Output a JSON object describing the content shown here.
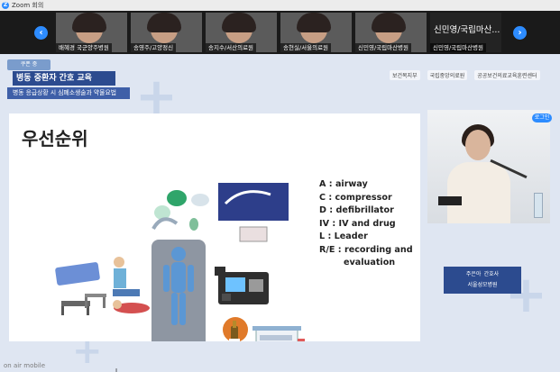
{
  "window": {
    "title": "Zoom 회의"
  },
  "gallery": {
    "tiles": [
      {
        "name": "배혜경 국군양주병원"
      },
      {
        "name": "송영주/고양정신"
      },
      {
        "name": "송지수/서산의료원"
      },
      {
        "name": "송현실/서울의료원"
      },
      {
        "name": "신민영/국립마산병원"
      },
      {
        "name": "신민영/국립마산병원",
        "big": "신민영/국립마산..."
      }
    ]
  },
  "banner": {
    "logo": "쿠폰 중",
    "title": "병동 중환자 간호 교육",
    "subtitle": "병동 응급상황 시 심폐소생술과 약물요법"
  },
  "orgs": [
    "보건복지부",
    "국립중앙의료원",
    "공공보건의료교육훈련센터"
  ],
  "slide": {
    "title": "우선순위",
    "items": [
      "A : airway",
      "C : compressor",
      "D : defibrillator",
      "IV : IV and drug",
      "L : Leader",
      "R/E : recording and",
      "evaluation"
    ],
    "leader_marker": "L"
  },
  "speaker": {
    "name": "주은아",
    "role": "간호사",
    "org": "서울성모병원",
    "badge": "로그인"
  },
  "watermark": "on air mobile",
  "colors": {
    "banner": "#2c4b8f",
    "zoom_blue": "#2d8cff",
    "orange": "#e07a2a"
  }
}
